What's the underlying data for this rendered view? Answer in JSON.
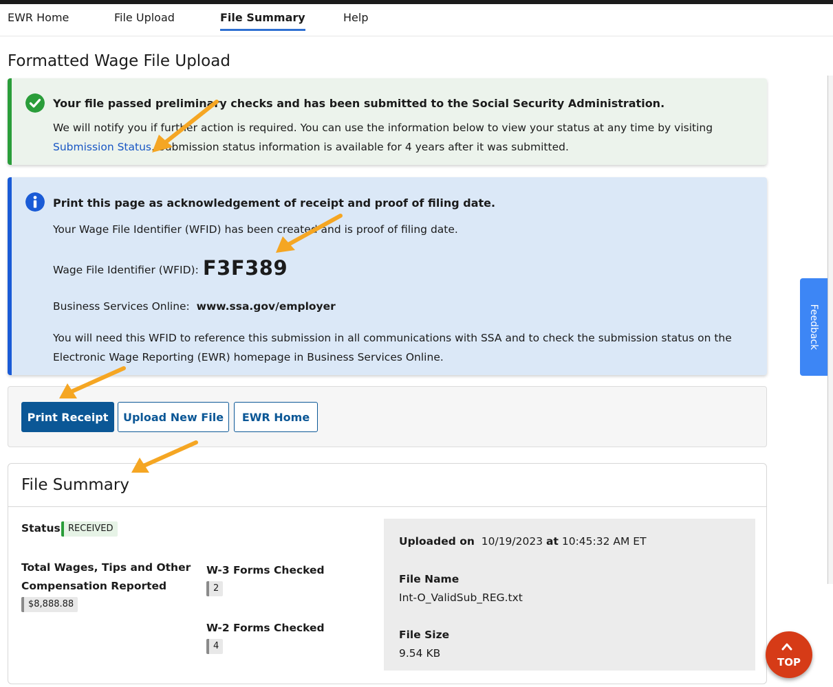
{
  "nav": {
    "items": [
      {
        "label": "EWR Home"
      },
      {
        "label": "File Upload"
      },
      {
        "label": "File Summary",
        "active": true
      },
      {
        "label": "Help"
      }
    ]
  },
  "page": {
    "title": "Formatted Wage File Upload"
  },
  "success_alert": {
    "heading": "Your file passed preliminary checks and has been submitted to the Social Security Administration.",
    "body_before_link": "We will notify you if further action is required. You can use the information below to view your status at any time by visiting ",
    "link": "Submission Status",
    "body_after_link": ". Submission status information is available for 4 years after it was submitted."
  },
  "info_alert": {
    "heading": "Print this page as acknowledgement of receipt and proof of filing date.",
    "line1": "Your Wage File Identifier (WFID) has been created and is proof of filing date.",
    "wfid_label": "Wage File Identifier (WFID):",
    "wfid_value": "F3F389",
    "bso_label": "Business Services Online:",
    "bso_url": "www.ssa.gov/employer",
    "note": "You will need this WFID to reference this submission in all communications with SSA and to check the submission status on the Electronic Wage Reporting (EWR) homepage in Business Services Online."
  },
  "buttons": {
    "print": "Print Receipt",
    "upload": "Upload New File",
    "home": "EWR Home"
  },
  "summary": {
    "title": "File Summary",
    "status_label": "Status:",
    "status_value": "RECEIVED",
    "wages_label": "Total Wages, Tips and Other Compensation Reported",
    "wages_value": "$8,888.88",
    "w3_label": "W-3 Forms Checked",
    "w3_value": "2",
    "w2_label": "W-2 Forms Checked",
    "w2_value": "4",
    "uploaded_on_label": "Uploaded on",
    "uploaded_date": "10/19/2023",
    "at_label": "at",
    "uploaded_time": "10:45:32 AM ET",
    "file_name_label": "File Name",
    "file_name": "Int-O_ValidSub_REG.txt",
    "file_size_label": "File Size",
    "file_size": "9.54 KB"
  },
  "feedback": {
    "label": "Feedback"
  },
  "top_button": {
    "label": "TOP"
  },
  "colors": {
    "success": "#2a9d3a",
    "info": "#1a5bd6",
    "primary": "#0b5796",
    "link": "#1856c4",
    "annotation_arrow": "#f5a623",
    "top_button": "#d63b17",
    "feedback": "#3d86f5"
  }
}
